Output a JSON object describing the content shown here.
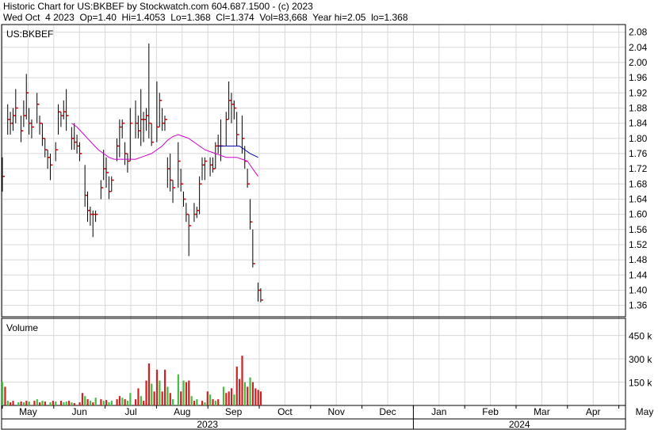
{
  "header": {
    "line1": "Historic Chart for US:BKBEF by Stockwatch.com 604.687.1500 - (c) 2023",
    "line2": "Wed Oct  4 2023  Op=1.40  Hi=1.4053  Lo=1.368  Cl=1.374  Vol=83,668  Year hi=2.05  lo=1.368"
  },
  "colors": {
    "grid": "#d8d8d8",
    "bar": "#000000",
    "close_tick": "#cc0000",
    "ma_short": "#0000aa",
    "ma_long": "#cc00cc",
    "vol_up": "#44bb44",
    "vol_down": "#cc2222"
  },
  "chart_data": [
    {
      "type": "ohlc",
      "title": "US:BKBEF",
      "ylim": [
        1.33,
        2.1
      ],
      "y_ticks": [
        "2.08",
        "2.04",
        "2.00",
        "1.96",
        "1.92",
        "1.88",
        "1.84",
        "1.80",
        "1.76",
        "1.72",
        "1.68",
        "1.64",
        "1.60",
        "1.56",
        "1.52",
        "1.48",
        "1.44",
        "1.40",
        "1.36"
      ],
      "x_months": [
        "May",
        "Jun",
        "Jul",
        "Aug",
        "Sep",
        "Oct",
        "Nov",
        "Dec",
        "Jan",
        "Feb",
        "Mar",
        "Apr",
        "May"
      ],
      "years": [
        "2023",
        "2024"
      ],
      "bars": [
        [
          0,
          1.75,
          1.66,
          1.7
        ],
        [
          2,
          1.89,
          1.81,
          1.85
        ],
        [
          3,
          1.87,
          1.81,
          1.84
        ],
        [
          4,
          1.88,
          1.82,
          1.86
        ],
        [
          5,
          1.93,
          1.84,
          1.88
        ],
        [
          7,
          1.86,
          1.79,
          1.82
        ],
        [
          8,
          1.9,
          1.83,
          1.86
        ],
        [
          9,
          1.97,
          1.85,
          1.92
        ],
        [
          10,
          1.88,
          1.81,
          1.84
        ],
        [
          11,
          1.85,
          1.8,
          1.83
        ],
        [
          13,
          1.92,
          1.84,
          1.89
        ],
        [
          14,
          1.86,
          1.81,
          1.84
        ],
        [
          15,
          1.84,
          1.78,
          1.8
        ],
        [
          16,
          1.8,
          1.75,
          1.77
        ],
        [
          17,
          1.77,
          1.72,
          1.75
        ],
        [
          18,
          1.76,
          1.69,
          1.73
        ],
        [
          20,
          1.79,
          1.74,
          1.77
        ],
        [
          21,
          1.89,
          1.81,
          1.87
        ],
        [
          22,
          1.87,
          1.83,
          1.86
        ],
        [
          23,
          1.9,
          1.85,
          1.87
        ],
        [
          24,
          1.93,
          1.82,
          1.86
        ],
        [
          26,
          1.83,
          1.77,
          1.8
        ],
        [
          27,
          1.84,
          1.77,
          1.79
        ],
        [
          28,
          1.81,
          1.76,
          1.78
        ],
        [
          29,
          1.79,
          1.74,
          1.76
        ],
        [
          31,
          1.73,
          1.62,
          1.65
        ],
        [
          32,
          1.66,
          1.58,
          1.61
        ],
        [
          33,
          1.62,
          1.57,
          1.6
        ],
        [
          34,
          1.61,
          1.54,
          1.6
        ],
        [
          35,
          1.61,
          1.58,
          1.6
        ],
        [
          37,
          1.69,
          1.64,
          1.67
        ],
        [
          38,
          1.77,
          1.69,
          1.72
        ],
        [
          39,
          1.75,
          1.67,
          1.71
        ],
        [
          40,
          1.7,
          1.64,
          1.66
        ],
        [
          41,
          1.7,
          1.66,
          1.69
        ],
        [
          43,
          1.8,
          1.74,
          1.78
        ],
        [
          44,
          1.85,
          1.75,
          1.83
        ],
        [
          45,
          1.85,
          1.8,
          1.84
        ],
        [
          46,
          1.79,
          1.73,
          1.76
        ],
        [
          47,
          1.76,
          1.71,
          1.74
        ],
        [
          48,
          1.88,
          1.74,
          1.84
        ],
        [
          50,
          1.9,
          1.8,
          1.84
        ],
        [
          51,
          1.86,
          1.8,
          1.82
        ],
        [
          52,
          1.93,
          1.78,
          1.85
        ],
        [
          53,
          1.87,
          1.79,
          1.85
        ],
        [
          54,
          1.88,
          1.82,
          1.86
        ],
        [
          55,
          2.05,
          1.8,
          1.84
        ],
        [
          56,
          1.84,
          1.78,
          1.79
        ],
        [
          58,
          1.95,
          1.79,
          1.83
        ],
        [
          59,
          1.92,
          1.83,
          1.9
        ],
        [
          60,
          1.88,
          1.82,
          1.84
        ],
        [
          61,
          1.86,
          1.82,
          1.85
        ],
        [
          62,
          1.75,
          1.67,
          1.72
        ],
        [
          63,
          1.76,
          1.66,
          1.69
        ],
        [
          64,
          1.69,
          1.63,
          1.67
        ],
        [
          66,
          1.79,
          1.67,
          1.74
        ],
        [
          67,
          1.72,
          1.66,
          1.68
        ],
        [
          68,
          1.66,
          1.62,
          1.64
        ],
        [
          69,
          1.63,
          1.58,
          1.6
        ],
        [
          70,
          1.6,
          1.49,
          1.57
        ],
        [
          72,
          1.63,
          1.58,
          1.6
        ],
        [
          73,
          1.62,
          1.59,
          1.61
        ],
        [
          74,
          1.7,
          1.6,
          1.68
        ],
        [
          75,
          1.75,
          1.69,
          1.73
        ],
        [
          76,
          1.75,
          1.69,
          1.74
        ],
        [
          78,
          1.75,
          1.7,
          1.73
        ],
        [
          79,
          1.75,
          1.71,
          1.72
        ],
        [
          80,
          1.79,
          1.72,
          1.78
        ],
        [
          81,
          1.81,
          1.76,
          1.78
        ],
        [
          82,
          1.85,
          1.74,
          1.78
        ],
        [
          84,
          1.87,
          1.78,
          1.85
        ],
        [
          85,
          1.95,
          1.85,
          1.9
        ],
        [
          86,
          1.92,
          1.84,
          1.89
        ],
        [
          87,
          1.9,
          1.85,
          1.88
        ],
        [
          88,
          1.87,
          1.78,
          1.81
        ],
        [
          90,
          1.86,
          1.76,
          1.8
        ],
        [
          91,
          1.78,
          1.72,
          1.74
        ],
        [
          92,
          1.72,
          1.67,
          1.68
        ],
        [
          93,
          1.64,
          1.56,
          1.58
        ],
        [
          94,
          1.56,
          1.46,
          1.47
        ],
        [
          96,
          1.42,
          1.37,
          1.4
        ],
        [
          97,
          1.405,
          1.368,
          1.374
        ]
      ],
      "ma_short": [
        [
          81,
          1.78
        ],
        [
          83,
          1.78
        ],
        [
          85,
          1.78
        ],
        [
          87,
          1.78
        ],
        [
          89,
          1.78
        ],
        [
          91,
          1.77
        ],
        [
          93,
          1.76
        ],
        [
          96,
          1.75
        ]
      ],
      "ma_long": [
        [
          26,
          1.84
        ],
        [
          28,
          1.83
        ],
        [
          30,
          1.815
        ],
        [
          32,
          1.8
        ],
        [
          34,
          1.785
        ],
        [
          36,
          1.77
        ],
        [
          38,
          1.76
        ],
        [
          40,
          1.75
        ],
        [
          42,
          1.745
        ],
        [
          44,
          1.745
        ],
        [
          46,
          1.745
        ],
        [
          48,
          1.745
        ],
        [
          50,
          1.745
        ],
        [
          52,
          1.75
        ],
        [
          54,
          1.755
        ],
        [
          56,
          1.76
        ],
        [
          58,
          1.77
        ],
        [
          60,
          1.78
        ],
        [
          62,
          1.795
        ],
        [
          64,
          1.805
        ],
        [
          66,
          1.81
        ],
        [
          68,
          1.805
        ],
        [
          70,
          1.8
        ],
        [
          72,
          1.79
        ],
        [
          74,
          1.78
        ],
        [
          76,
          1.77
        ],
        [
          78,
          1.765
        ],
        [
          80,
          1.76
        ],
        [
          82,
          1.755
        ],
        [
          84,
          1.75
        ],
        [
          86,
          1.75
        ],
        [
          88,
          1.75
        ],
        [
          90,
          1.745
        ],
        [
          92,
          1.74
        ],
        [
          94,
          1.72
        ],
        [
          96,
          1.7
        ]
      ]
    },
    {
      "type": "bar",
      "title": "Volume",
      "ylim": [
        0,
        560000
      ],
      "y_tick_labels": [
        "450 k",
        "300 k",
        "150 k"
      ],
      "y_tick_values": [
        450000,
        300000,
        150000
      ],
      "bars": [
        [
          0,
          150000,
          "u"
        ],
        [
          1,
          120000,
          "d"
        ],
        [
          2,
          30000,
          "u"
        ],
        [
          3,
          20000,
          "d"
        ],
        [
          4,
          30000,
          "d"
        ],
        [
          6,
          20000,
          "u"
        ],
        [
          7,
          25000,
          "d"
        ],
        [
          8,
          20000,
          "u"
        ],
        [
          9,
          30000,
          "d"
        ],
        [
          10,
          25000,
          "u"
        ],
        [
          12,
          30000,
          "d"
        ],
        [
          13,
          40000,
          "u"
        ],
        [
          14,
          20000,
          "d"
        ],
        [
          15,
          30000,
          "u"
        ],
        [
          16,
          25000,
          "d"
        ],
        [
          18,
          20000,
          "u"
        ],
        [
          19,
          30000,
          "d"
        ],
        [
          20,
          25000,
          "u"
        ],
        [
          22,
          30000,
          "d"
        ],
        [
          23,
          20000,
          "u"
        ],
        [
          24,
          25000,
          "u"
        ],
        [
          25,
          30000,
          "d"
        ],
        [
          26,
          20000,
          "u"
        ],
        [
          27,
          15000,
          "d"
        ],
        [
          29,
          20000,
          "d"
        ],
        [
          30,
          80000,
          "d"
        ],
        [
          31,
          60000,
          "u"
        ],
        [
          32,
          40000,
          "d"
        ],
        [
          33,
          30000,
          "u"
        ],
        [
          34,
          20000,
          "d"
        ],
        [
          35,
          50000,
          "u"
        ],
        [
          37,
          40000,
          "d"
        ],
        [
          38,
          30000,
          "u"
        ],
        [
          39,
          35000,
          "d"
        ],
        [
          40,
          20000,
          "u"
        ],
        [
          41,
          30000,
          "u"
        ],
        [
          43,
          40000,
          "d"
        ],
        [
          44,
          60000,
          "d"
        ],
        [
          45,
          50000,
          "u"
        ],
        [
          46,
          40000,
          "d"
        ],
        [
          47,
          30000,
          "u"
        ],
        [
          48,
          80000,
          "u"
        ],
        [
          50,
          40000,
          "d"
        ],
        [
          51,
          110000,
          "d"
        ],
        [
          52,
          60000,
          "u"
        ],
        [
          53,
          30000,
          "d"
        ],
        [
          54,
          160000,
          "d"
        ],
        [
          55,
          270000,
          "d"
        ],
        [
          56,
          140000,
          "u"
        ],
        [
          57,
          90000,
          "d"
        ],
        [
          58,
          230000,
          "d"
        ],
        [
          59,
          160000,
          "u"
        ],
        [
          60,
          90000,
          "d"
        ],
        [
          61,
          230000,
          "d"
        ],
        [
          62,
          120000,
          "u"
        ],
        [
          63,
          80000,
          "d"
        ],
        [
          64,
          40000,
          "u"
        ],
        [
          66,
          200000,
          "u"
        ],
        [
          67,
          90000,
          "d"
        ],
        [
          68,
          160000,
          "u"
        ],
        [
          69,
          150000,
          "d"
        ],
        [
          70,
          160000,
          "d"
        ],
        [
          71,
          60000,
          "u"
        ],
        [
          72,
          30000,
          "d"
        ],
        [
          73,
          40000,
          "u"
        ],
        [
          75,
          30000,
          "d"
        ],
        [
          76,
          20000,
          "u"
        ],
        [
          77,
          90000,
          "d"
        ],
        [
          78,
          70000,
          "u"
        ],
        [
          79,
          40000,
          "d"
        ],
        [
          80,
          30000,
          "u"
        ],
        [
          81,
          40000,
          "d"
        ],
        [
          83,
          120000,
          "u"
        ],
        [
          84,
          80000,
          "d"
        ],
        [
          85,
          90000,
          "d"
        ],
        [
          86,
          110000,
          "d"
        ],
        [
          87,
          70000,
          "u"
        ],
        [
          88,
          250000,
          "d"
        ],
        [
          89,
          170000,
          "d"
        ],
        [
          90,
          320000,
          "d"
        ],
        [
          91,
          150000,
          "u"
        ],
        [
          92,
          120000,
          "d"
        ],
        [
          93,
          180000,
          "u"
        ],
        [
          94,
          150000,
          "d"
        ],
        [
          95,
          110000,
          "d"
        ],
        [
          96,
          100000,
          "d"
        ],
        [
          97,
          90000,
          "d"
        ]
      ]
    }
  ]
}
